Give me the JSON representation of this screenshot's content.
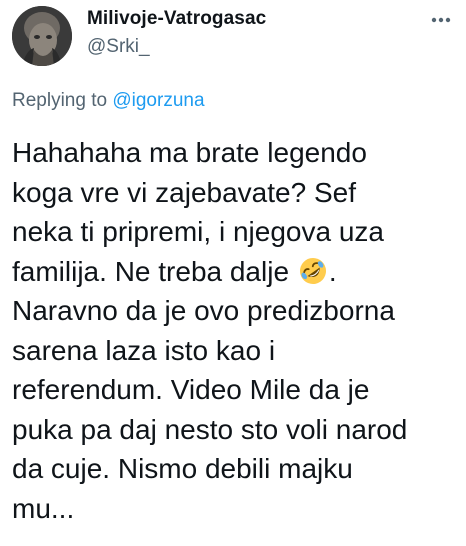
{
  "author": {
    "display_name": "Milivoje-Vatrogasac",
    "handle": "@Srki_"
  },
  "icons": {
    "more": "more-horizontal-icon",
    "emoji": "rolling-on-floor-laughing-emoji"
  },
  "reply": {
    "prefix": "Replying to",
    "mention": "@igorzuna"
  },
  "tweet": {
    "lines": [
      "Hahahaha ma brate legendo",
      "koga vre vi zajebavate? Sef",
      "neka ti pripremi, i njegova uza",
      "familija. Ne treba dalje",
      ".",
      "Naravno da je ovo predizborna",
      "sarena laza isto kao i",
      "referendum. Video Mile da je",
      "puka pa daj nesto sto voli narod",
      "da cuje. Nismo debili majku",
      "mu..."
    ]
  },
  "colors": {
    "text": "#0f1419",
    "secondary": "#536471",
    "link": "#1d9bf0",
    "emoji_face": "#ffcc4d"
  }
}
